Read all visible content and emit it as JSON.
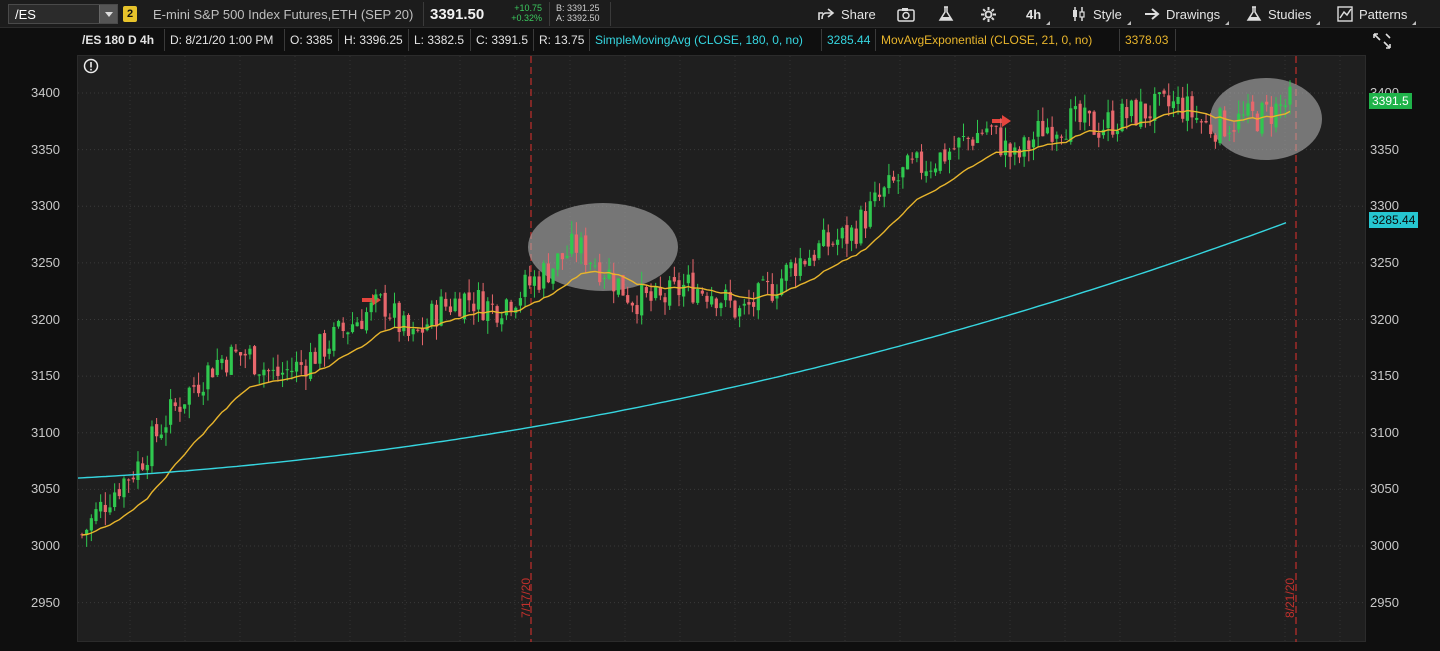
{
  "toolbar": {
    "symbol": "/ES",
    "link_group": "2",
    "description": "E-mini S&P 500 Index Futures,ETH (SEP 20)",
    "last": "3391.50",
    "net_change": "+10.75",
    "pct_change": "+0.32%",
    "bid": "B: 3391.25",
    "ask": "A: 3392.50",
    "share_label": "Share",
    "timeframe_label": "4h",
    "style_label": "Style",
    "drawings_label": "Drawings",
    "studies_label": "Studies",
    "patterns_label": "Patterns"
  },
  "info_bar": {
    "symbol_period": "/ES 180 D 4h",
    "date": "D: 8/21/20 1:00 PM",
    "open": "O: 3385",
    "high": "H: 3396.25",
    "low": "L: 3382.5",
    "close": "C: 3391.5",
    "range": "R: 13.75",
    "sma_label": "SimpleMovingAvg (CLOSE, 180, 0, no)",
    "sma_value": "3285.44",
    "ema_label": "MovAvgExponential (CLOSE, 21, 0, no)",
    "ema_value": "3378.03"
  },
  "price_tags": {
    "last": "3391.5",
    "sma": "3285.44"
  },
  "colors": {
    "up": "#2fc84f",
    "down": "#e8676c",
    "sma": "#36d6e0",
    "ema": "#e8b52c",
    "marker": "#c0302c",
    "arrow": "#e5453d"
  },
  "chart_data": {
    "type": "candlestick",
    "ylim": [
      2910,
      3440
    ],
    "yticks": [
      2950,
      3000,
      3050,
      3100,
      3150,
      3200,
      3250,
      3300,
      3350,
      3400
    ],
    "date_markers": [
      "7/17/20",
      "8/21/20"
    ],
    "trend": [
      3010,
      3045,
      3070,
      3110,
      3140,
      3165,
      3170,
      3150,
      3160,
      3180,
      3200,
      3215,
      3180,
      3210,
      3220,
      3210,
      3225,
      3245,
      3265,
      3245,
      3220,
      3215,
      3230,
      3225,
      3205,
      3225,
      3250,
      3265,
      3275,
      3305,
      3330,
      3340,
      3355,
      3370,
      3340,
      3370,
      3375,
      3370,
      3380,
      3385,
      3390,
      3370,
      3375,
      3380,
      3391.5
    ],
    "series": [
      {
        "name": "SimpleMovingAvg (CLOSE, 180, 0, no)",
        "start": 3060,
        "end": 3285.44
      },
      {
        "name": "MovAvgExponential (CLOSE, 21, 0, no)",
        "end": 3378.03
      }
    ]
  }
}
